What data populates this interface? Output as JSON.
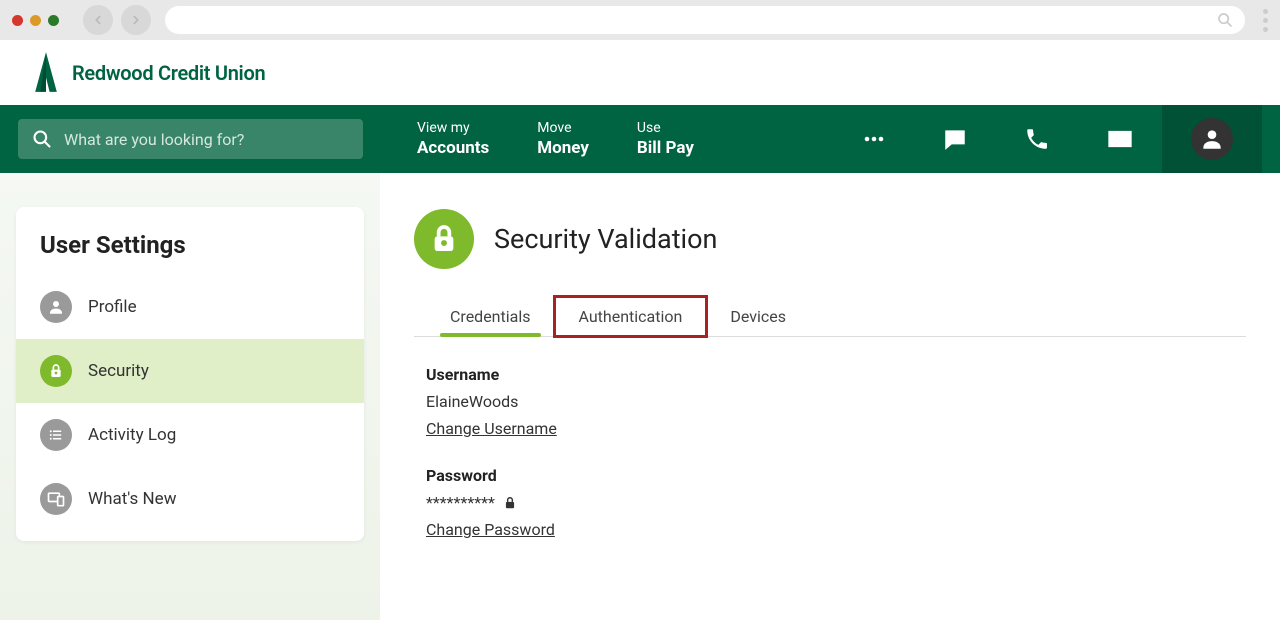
{
  "brand": {
    "name": "Redwood Credit Union"
  },
  "search": {
    "placeholder": "What are you looking for?"
  },
  "nav": {
    "items": [
      {
        "small": "View my",
        "big": "Accounts"
      },
      {
        "small": "Move",
        "big": "Money"
      },
      {
        "small": "Use",
        "big": "Bill Pay"
      }
    ]
  },
  "sidebar": {
    "title": "User Settings",
    "items": [
      {
        "label": "Profile"
      },
      {
        "label": "Security"
      },
      {
        "label": "Activity Log"
      },
      {
        "label": "What's New"
      }
    ]
  },
  "page": {
    "title": "Security Validation",
    "tabs": [
      {
        "label": "Credentials"
      },
      {
        "label": "Authentication"
      },
      {
        "label": "Devices"
      }
    ],
    "username_label": "Username",
    "username_value": "ElaineWoods",
    "change_username": "Change Username",
    "password_label": "Password",
    "password_value": "**********",
    "change_password": "Change Password"
  }
}
